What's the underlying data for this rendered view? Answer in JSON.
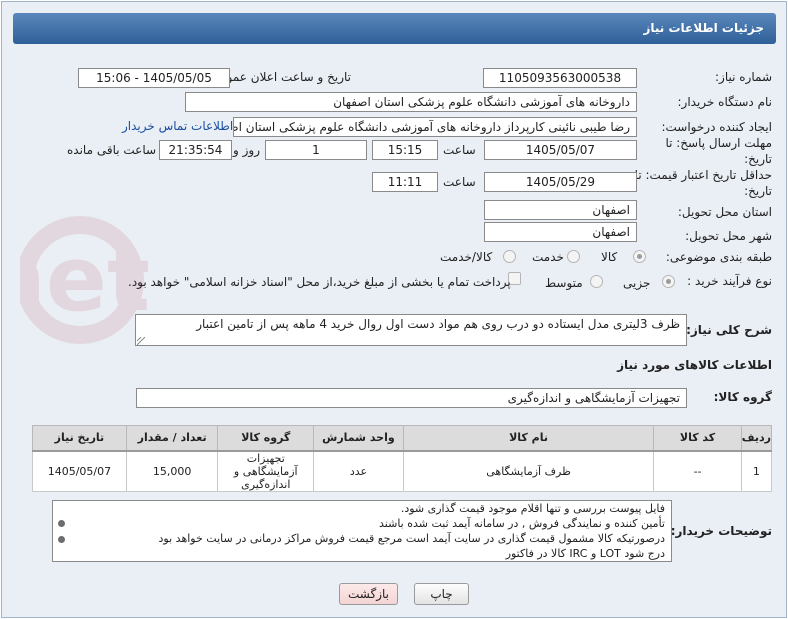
{
  "header": {
    "title": "جزئیات اطلاعات نیاز"
  },
  "need_number": {
    "label": "شماره نیاز:",
    "value": "1105093563000538"
  },
  "announce": {
    "label": "تاریخ و ساعت اعلان عمومی:",
    "value": "1405/05/05 - 15:06"
  },
  "buyer_org": {
    "label": "نام دستگاه خریدار:",
    "value": "داروخانه های آموزشی دانشگاه علوم پزشکی استان اصفهان"
  },
  "creator": {
    "label": "ایجاد کننده درخواست:",
    "value": "رضا طیبی نائینی کارپرداز داروخانه های آموزشی دانشگاه علوم پزشکی استان اصفهان",
    "contact_link": "اطلاعات تماس خریدار"
  },
  "deadline_reply": {
    "label": "مهلت ارسال پاسخ: تا تاریخ:",
    "date": "1405/05/07",
    "time_label": "ساعت",
    "time": "15:15",
    "days": "1",
    "days_label": "روز و",
    "remaining": "21:35:54",
    "remaining_label": "ساعت باقی مانده"
  },
  "price_validity": {
    "label": "حداقل تاریخ اعتبار قیمت: تا تاریخ:",
    "date": "1405/05/29",
    "time_label": "ساعت",
    "time": "11:11"
  },
  "delivery_province": {
    "label": "استان محل تحویل:",
    "value": "اصفهان"
  },
  "delivery_city": {
    "label": "شهر محل تحویل:",
    "value": "اصفهان"
  },
  "category": {
    "label": "طبقه بندی موضوعی:",
    "options": [
      "کالا",
      "خدمت",
      "کالا/خدمت"
    ],
    "selected": "کالا"
  },
  "purchase_process": {
    "label": "نوع فرآیند خرید :",
    "options": [
      "جزیی",
      "متوسط"
    ],
    "selected": "جزیی",
    "payment_note": "پرداخت تمام یا بخشی از مبلغ خرید،از محل \"اسناد خزانه اسلامی\" خواهد بود."
  },
  "general_description": {
    "label": "شرح کلی نیاز:",
    "value": "ظرف  3لیتری مدل ایستاده دو درب روی هم مواد دست اول روال خرید 4 ماهه پس از تامین اعتبار"
  },
  "goods_info": {
    "title": "اطلاعات کالاهای مورد نیاز"
  },
  "goods_group": {
    "label": "گروه کالا:",
    "value": "تجهیزات آزمایشگاهی و اندازه‌گیری"
  },
  "table": {
    "headers": [
      "ردیف",
      "کد کالا",
      "نام کالا",
      "واحد شمارش",
      "گروه کالا",
      "تعداد / مقدار",
      "تاریخ نیاز"
    ],
    "rows": [
      [
        "1",
        "--",
        "ظرف آزمایشگاهی",
        "عدد",
        "تجهیزات آزمایشگاهی و اندازه‌گیری",
        "15,000",
        "1405/05/07"
      ]
    ]
  },
  "buyer_notes": {
    "label": "توضیحات خریدار:",
    "lines": [
      "فایل پیوست بررسی و تنها اقلام موجود قیمت گذاری شود.",
      "تأمین کننده و نمایندگی فروش  , در سامانه آیمد ثبت شده باشند",
      "درصورتیکه کالا مشمول قیمت گذاری در سایت آیمد است مرجع قیمت فروش مراکز درمانی در سایت خواهد بود",
      "درج شود LOT و IRC کالا در فاکتور"
    ]
  },
  "buttons": {
    "print": "چاپ",
    "back": "بازگشت"
  },
  "colors": {
    "header": "#3b6aa5",
    "link": "#1a4fa0",
    "back_button": "#f7dede"
  }
}
